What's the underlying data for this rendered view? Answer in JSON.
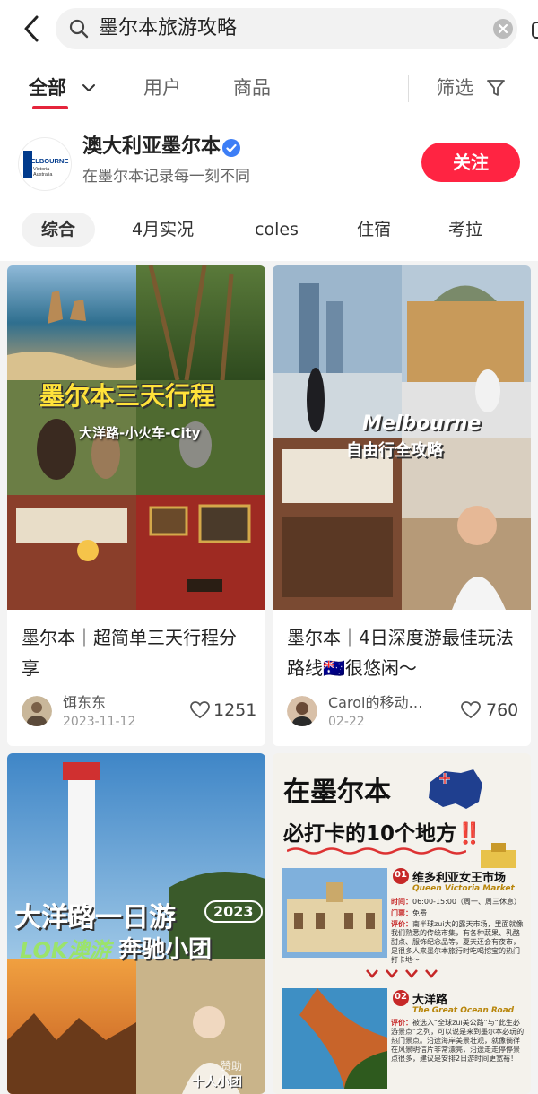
{
  "search": {
    "query": "墨尔本旅游攻略"
  },
  "tabs": {
    "all": "全部",
    "users": "用户",
    "goods": "商品",
    "filter": "筛选"
  },
  "account": {
    "name": "澳大利亚墨尔本",
    "desc": "在墨尔本记录每一刻不同",
    "follow": "关注",
    "logo_text": "MELBOURNE",
    "logo_sub1": "Victoria",
    "logo_sub2": "Australia",
    "chips": [
      "综合",
      "4月实况",
      "coles",
      "住宿",
      "考拉"
    ]
  },
  "notes": [
    {
      "title": "墨尔本｜超简单三天行程分享",
      "author": "饵东东",
      "date": "2023-11-12",
      "likes": "1251",
      "overlay_title": "墨尔本三天行程",
      "overlay_sub": "大洋路-小火车-City"
    },
    {
      "title": "墨尔本｜4日深度游最佳玩法路线🇦🇺很悠闲～",
      "author": "Carol的移动…",
      "date": "02-22",
      "likes": "760",
      "overlay_title": "Melbourne",
      "overlay_sub": "自由行全攻略"
    },
    {
      "overlay_title": "大洋路一日游",
      "overlay_year": "2023",
      "overlay_brand": "LOK澳游",
      "overlay_sub": "奔驰小团",
      "overlay_small": "十人小团",
      "overlay_tag": "赞助"
    },
    {
      "overlay_h1": "在墨尔本",
      "overlay_h2": "必打卡的10个地方‼️",
      "item1": {
        "num": "01",
        "name": "维多利亚女王市场",
        "en": "Queen Victoria Market",
        "time_label": "时间：",
        "time": "06:00-15:00（周一、周三休息）",
        "ticket_label": "门票：",
        "ticket": "免费",
        "review_label": "评价：",
        "review": "南半球zui大的露天市场，里面就像我们熟悉的传统市集，有各种蔬果、乳酪甜点、服饰纪念品等，夏天还会有夜市，是很多人来墨尔本旅行时吃喝挖宝的热门打卡地～"
      },
      "item2": {
        "num": "02",
        "name": "大洋路",
        "en": "The Great Ocean Road",
        "review_label": "评价：",
        "review": "被选入“全球zui美公路”与“此生必游景点”之列，可以说是来到墨尔本必玩的热门景点。沿途海岸美景壮观，就像徜徉在风景明信片非常漂亮，沿途走走停停景点很多，建议是安排2日游时间更宽裕！"
      }
    }
  ],
  "colors": {
    "accent": "#ff2442",
    "tab_underline": "#e5243b",
    "verified": "#3d7ef6"
  }
}
